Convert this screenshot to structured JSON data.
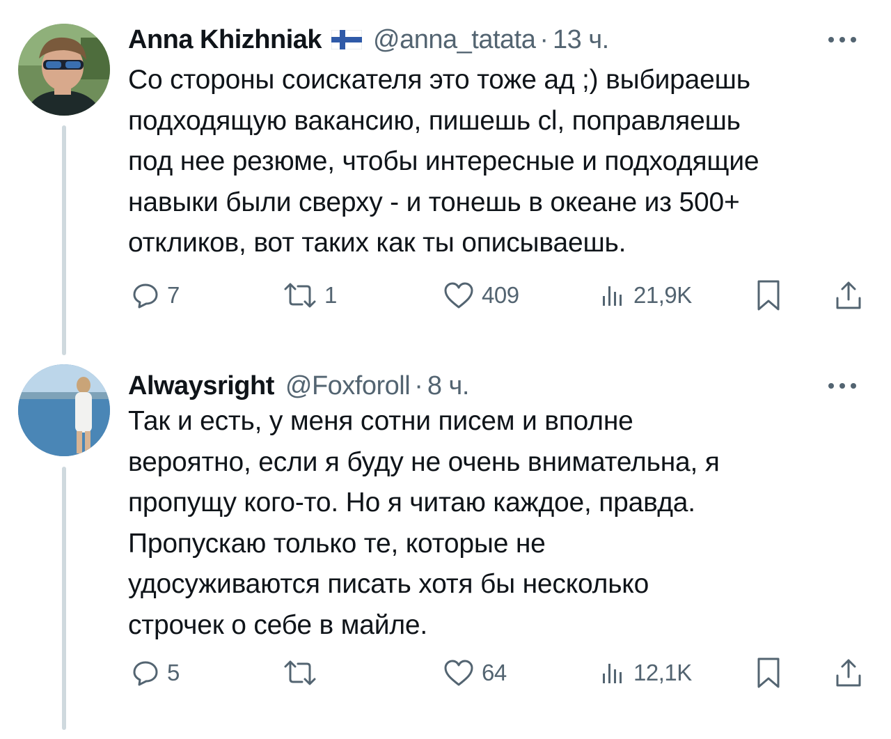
{
  "tweets": [
    {
      "display_name": "Anna Khizhniak",
      "flag_icon": "finland-flag-icon",
      "handle": "@anna_tatata",
      "separator": "·",
      "time": "13 ч.",
      "text_lines": [
        "Со стороны соискателя это тоже ад ;) выбираешь",
        "подходящую вакансию, пишешь cl, поправляешь",
        "под нее резюме, чтобы интересные и подходящие",
        "навыки были сверху - и тонешь в океане из 500+",
        "откликов, вот таких как ты описываешь."
      ],
      "replies": "7",
      "retweets": "1",
      "likes": "409",
      "views": "21,9K"
    },
    {
      "display_name": "Alwaysright",
      "handle": "@Foxforoll",
      "separator": "·",
      "time": "8 ч.",
      "text_lines": [
        "Так и есть, у меня сотни писем и вполне",
        "вероятно, если я буду не очень внимательна, я",
        "пропущу кого-то. Но я читаю каждое, правда.",
        "Пропускаю только те, которые не",
        "удосуживаются писать хотя бы несколько",
        "строчек о себе в майле."
      ],
      "replies": "5",
      "retweets": "",
      "likes": "64",
      "views": "12,1K"
    }
  ],
  "colors": {
    "text": "#0f1419",
    "secondary": "#536471",
    "thread_line": "#cfd9de",
    "background": "#ffffff"
  },
  "icons": [
    "reply-icon",
    "retweet-icon",
    "like-icon",
    "views-icon",
    "bookmark-icon",
    "share-icon",
    "more-icon"
  ]
}
